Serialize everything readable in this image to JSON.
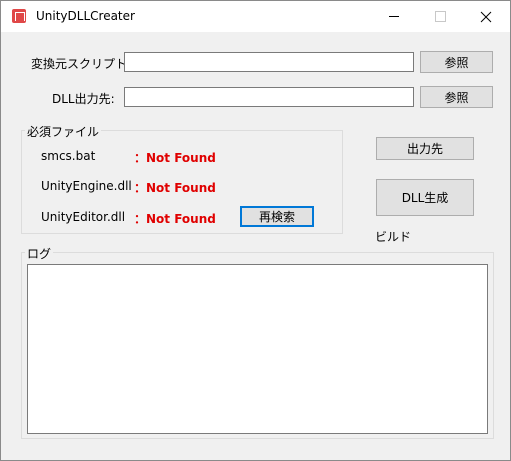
{
  "window": {
    "title": "UnityDLLCreater",
    "icon": "unity-app-icon",
    "controls": [
      "minimize-icon",
      "maximize-icon",
      "close-icon"
    ]
  },
  "form": {
    "source_script_label": "変換元スクリプト:",
    "source_script_value": "",
    "dll_output_label": "DLL出力先:",
    "dll_output_value": "",
    "browse_label": "参照"
  },
  "required_files": {
    "title": "必須ファイル",
    "items": [
      {
        "name": "smcs.bat",
        "status": "：Not Found"
      },
      {
        "name": "UnityEngine.dll",
        "status": "：Not Found"
      },
      {
        "name": "UnityEditor.dll",
        "status": "：Not Found"
      }
    ],
    "research_button": "再検索"
  },
  "actions": {
    "output_button": "出力先",
    "build_button": "DLL生成",
    "build_caption": "ビルド"
  },
  "log": {
    "title": "ログ",
    "content": ""
  },
  "colors": {
    "status_error": "#e00000",
    "focus_border": "#0078d7",
    "window_bg": "#f0f0f0"
  }
}
